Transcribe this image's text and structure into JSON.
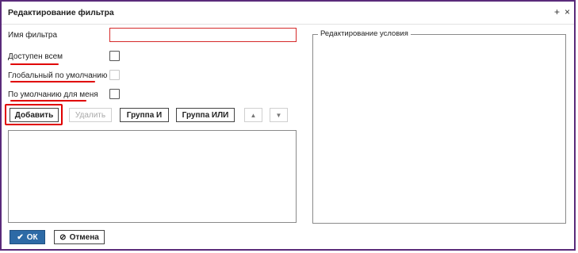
{
  "dialog": {
    "title": "Редактирование фильтра",
    "pin_icon": "+",
    "close_icon": "×"
  },
  "form": {
    "name_label": "Имя фильтра",
    "name_value": "",
    "available_all_label": "Доступен всем",
    "global_default_label": "Глобальный по умолчанию",
    "default_for_me_label": "По умолчанию для меня"
  },
  "toolbar": {
    "add_label": "Добавить",
    "delete_label": "Удалить",
    "group_and_label": "Группа И",
    "group_or_label": "Группа ИЛИ",
    "up_icon": "▲",
    "down_icon": "▼"
  },
  "condition_panel": {
    "legend": "Редактирование условия"
  },
  "footer": {
    "ok_icon": "✔",
    "ok_label": "ОК",
    "cancel_icon": "⊘",
    "cancel_label": "Отмена"
  },
  "colors": {
    "accent": "#2d6aa6",
    "window_border": "#5a2a7a",
    "annotation_red": "#e00000"
  }
}
